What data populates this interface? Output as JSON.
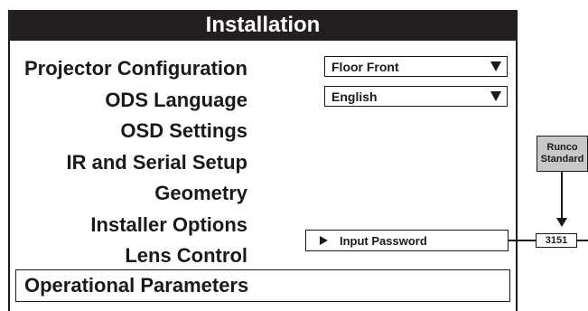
{
  "window": {
    "title": "Installation"
  },
  "menu": {
    "items": [
      "Projector Configuration",
      "ODS Language",
      "OSD Settings",
      "IR and Serial Setup",
      "Geometry",
      "Installer Options",
      "Lens Control"
    ],
    "selected": "Operational Parameters"
  },
  "settings": {
    "projector_configuration": {
      "value": "Floor Front"
    },
    "ods_language": {
      "value": "English"
    },
    "input_password": {
      "label": "Input Password",
      "value": "3151"
    }
  },
  "callout": {
    "line1": "Runco",
    "line2": "Standard"
  },
  "colors": {
    "title_bar": "#231f20",
    "callout_fill": "#c8c8c8",
    "border": "#1a1a1a"
  }
}
